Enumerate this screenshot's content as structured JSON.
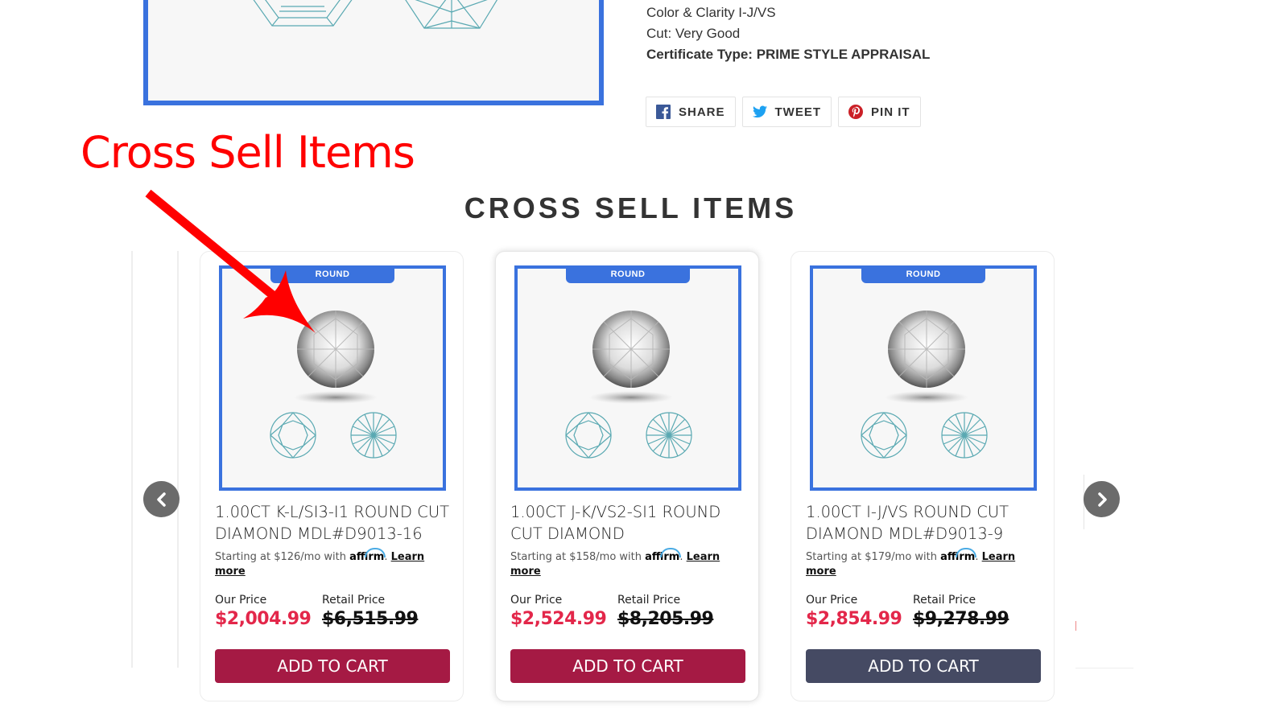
{
  "product_details": {
    "color_clarity": "Color & Clarity I-J/VS",
    "cut": "Cut: Very Good",
    "certificate_label": "Certificate Type:",
    "certificate_value": "PRIME STYLE APPRAISAL"
  },
  "share": {
    "buttons": [
      {
        "label": "SHARE",
        "icon": "facebook-icon",
        "color": "#3b5998"
      },
      {
        "label": "TWEET",
        "icon": "twitter-icon",
        "color": "#1da1f2"
      },
      {
        "label": "PIN IT",
        "icon": "pinterest-icon",
        "color": "#cb2027"
      }
    ]
  },
  "annotation": {
    "text": "Cross Sell Items",
    "color": "#ff0000"
  },
  "section": {
    "title": "CROSS SELL ITEMS"
  },
  "carousel": {
    "prev_icon": "chevron-left-icon",
    "next_icon": "chevron-right-icon",
    "items": [
      {
        "shape": "ROUND",
        "title": "1.00CT K-L/SI3-I1 ROUND CUT DIAMOND MDL#D9013-16",
        "affirm_prefix": "Starting at $126/mo with",
        "affirm_logo": "affirm",
        "learn_more": "Learn more",
        "our_price_label": "Our Price",
        "our_price": "$2,004.99",
        "retail_price_label": "Retail Price",
        "retail_price": "$6,515.99",
        "button": "ADD TO CART"
      },
      {
        "shape": "ROUND",
        "title": "1.00CT J-K/VS2-SI1 ROUND CUT DIAMOND",
        "affirm_prefix": "Starting at $158/mo with",
        "affirm_logo": "affirm",
        "learn_more": "Learn more",
        "our_price_label": "Our Price",
        "our_price": "$2,524.99",
        "retail_price_label": "Retail Price",
        "retail_price": "$8,205.99",
        "button": "ADD TO CART"
      },
      {
        "shape": "ROUND",
        "title": "1.00CT I-J/VS ROUND CUT DIAMOND MDL#D9013-9",
        "affirm_prefix": "Starting at $179/mo with",
        "affirm_logo": "affirm",
        "learn_more": "Learn more",
        "our_price_label": "Our Price",
        "our_price": "$2,854.99",
        "retail_price_label": "Retail Price",
        "retail_price": "$9,278.99",
        "button": "ADD TO CART"
      }
    ]
  },
  "colors": {
    "accent_blue": "#3a72de",
    "price_red": "#e3274a",
    "cart_red": "#a51a44",
    "cart_dark": "#454a63",
    "diagram_teal": "#4aa3ad"
  }
}
